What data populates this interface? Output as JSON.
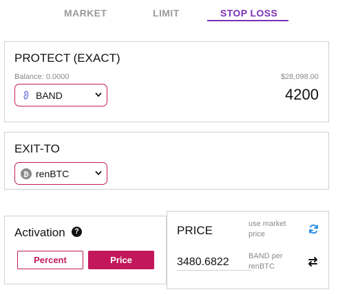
{
  "tabs": {
    "market": "MARKET",
    "limit": "LIMIT",
    "stop_loss": "STOP LOSS",
    "active": "STOP LOSS"
  },
  "protect": {
    "title": "PROTECT (EXACT)",
    "balance": "Balance: 0.0000",
    "usd_value": "$28,098.00",
    "amount": "4200",
    "token": "BAND",
    "token_icon": "band-protocol-icon"
  },
  "exit_to": {
    "title": "EXIT-TO",
    "token": "renBTC",
    "token_icon": "bitcoin-icon"
  },
  "activation": {
    "label": "Activation",
    "help_icon": "question-circle-icon",
    "percent_label": "Percent",
    "price_label": "Price",
    "selected": "Price"
  },
  "price": {
    "title": "PRICE",
    "use_market": "use market price",
    "value": "3480.6822",
    "pair": "BAND per renBTC",
    "refresh_icon": "refresh-icon",
    "swap_icon": "swap-icon"
  },
  "colors": {
    "accent_purple": "#7b2fb3",
    "accent_pink": "#c2185b",
    "refresh_blue": "#1e88e5",
    "band_icon": "#7b7fe0",
    "muted_text": "#888888",
    "border": "#cfcfcf"
  }
}
